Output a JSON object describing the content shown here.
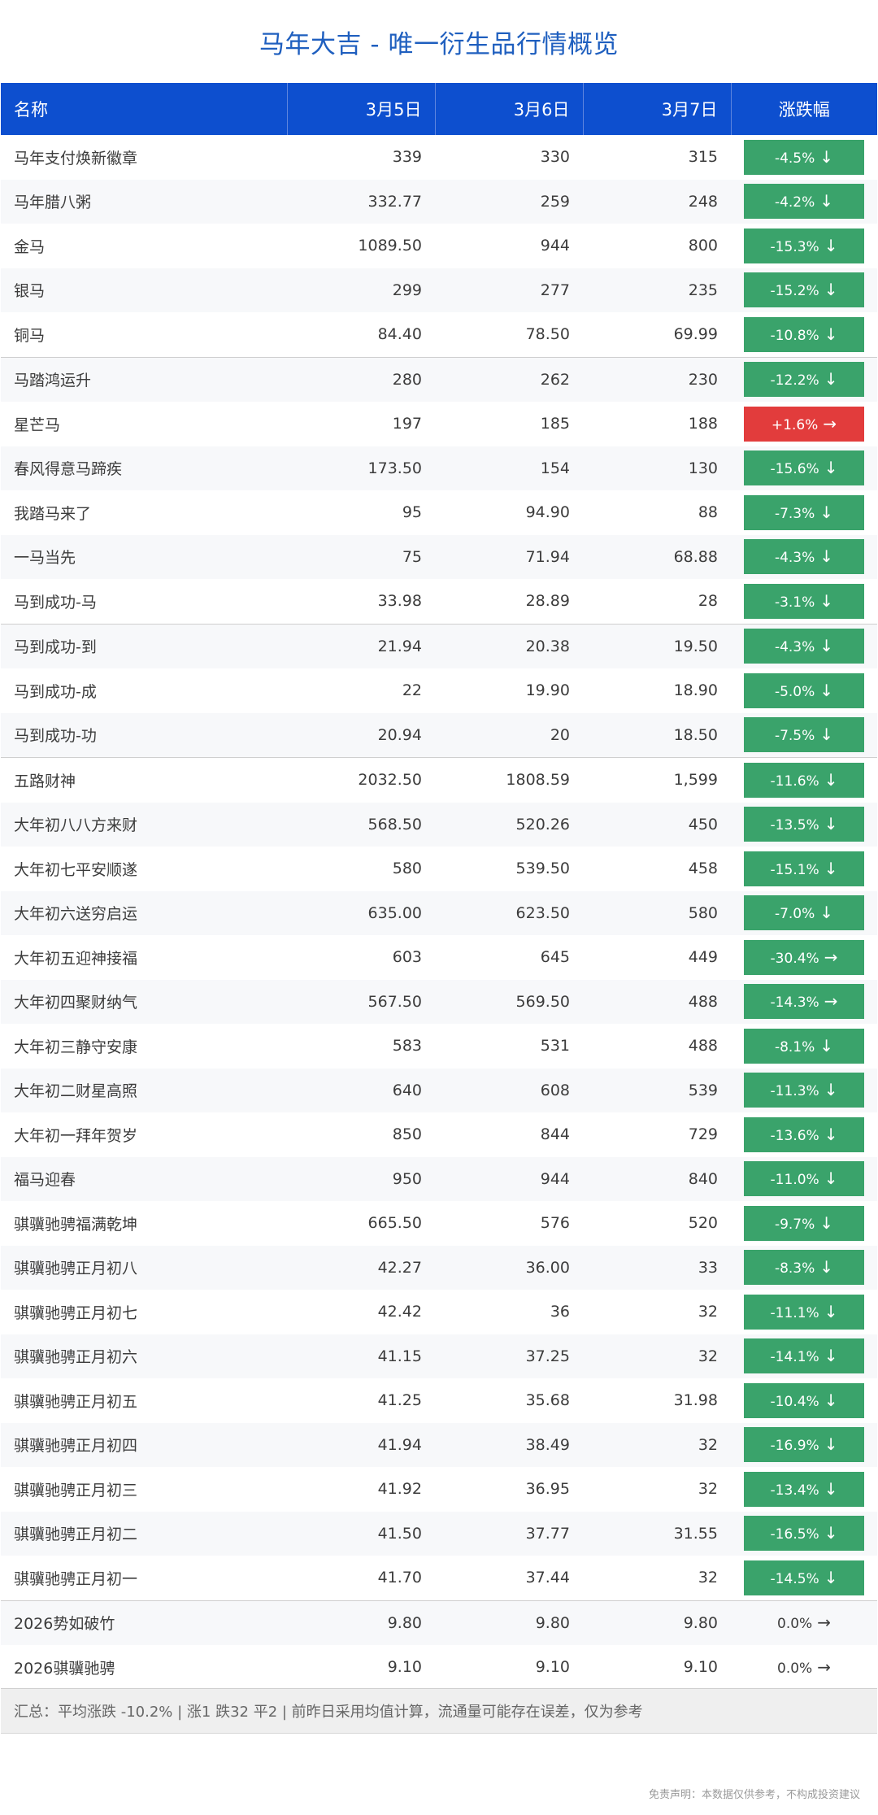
{
  "title": "马年大吉 - 唯一衍生品行情概览",
  "headers": {
    "name": "名称",
    "d1": "3月5日",
    "d2": "3月6日",
    "d3": "3月7日",
    "change": "涨跌幅"
  },
  "colors": {
    "header_bg": "#0d4fcf",
    "title": "#1f5fbf",
    "down": "#3aa36b",
    "up": "#e23c3c"
  },
  "icons": {
    "down": "arrow-down-icon",
    "right": "arrow-right-icon"
  },
  "rows": [
    {
      "name": "马年支付焕新徽章",
      "d1": "339",
      "d2": "330",
      "d3": "315",
      "change": "-4.5%",
      "dir": "down",
      "arrow": "↓",
      "gap": false
    },
    {
      "name": "马年腊八粥",
      "d1": "332.77",
      "d2": "259",
      "d3": "248",
      "change": "-4.2%",
      "dir": "down",
      "arrow": "↓",
      "gap": false
    },
    {
      "name": "金马",
      "d1": "1089.50",
      "d2": "944",
      "d3": "800",
      "change": "-15.3%",
      "dir": "down",
      "arrow": "↓",
      "gap": false
    },
    {
      "name": "银马",
      "d1": "299",
      "d2": "277",
      "d3": "235",
      "change": "-15.2%",
      "dir": "down",
      "arrow": "↓",
      "gap": false
    },
    {
      "name": "铜马",
      "d1": "84.40",
      "d2": "78.50",
      "d3": "69.99",
      "change": "-10.8%",
      "dir": "down",
      "arrow": "↓",
      "gap": false
    },
    {
      "name": "马踏鸿运升",
      "d1": "280",
      "d2": "262",
      "d3": "230",
      "change": "-12.2%",
      "dir": "down",
      "arrow": "↓",
      "gap": true
    },
    {
      "name": "星芒马",
      "d1": "197",
      "d2": "185",
      "d3": "188",
      "change": "+1.6%",
      "dir": "up",
      "arrow": "→",
      "gap": false
    },
    {
      "name": "春风得意马蹄疾",
      "d1": "173.50",
      "d2": "154",
      "d3": "130",
      "change": "-15.6%",
      "dir": "down",
      "arrow": "↓",
      "gap": false
    },
    {
      "name": "我踏马来了",
      "d1": "95",
      "d2": "94.90",
      "d3": "88",
      "change": "-7.3%",
      "dir": "down",
      "arrow": "↓",
      "gap": false
    },
    {
      "name": "一马当先",
      "d1": "75",
      "d2": "71.94",
      "d3": "68.88",
      "change": "-4.3%",
      "dir": "down",
      "arrow": "↓",
      "gap": false
    },
    {
      "name": "马到成功-马",
      "d1": "33.98",
      "d2": "28.89",
      "d3": "28",
      "change": "-3.1%",
      "dir": "down",
      "arrow": "↓",
      "gap": false
    },
    {
      "name": "马到成功-到",
      "d1": "21.94",
      "d2": "20.38",
      "d3": "19.50",
      "change": "-4.3%",
      "dir": "down",
      "arrow": "↓",
      "gap": true
    },
    {
      "name": "马到成功-成",
      "d1": "22",
      "d2": "19.90",
      "d3": "18.90",
      "change": "-5.0%",
      "dir": "down",
      "arrow": "↓",
      "gap": false
    },
    {
      "name": "马到成功-功",
      "d1": "20.94",
      "d2": "20",
      "d3": "18.50",
      "change": "-7.5%",
      "dir": "down",
      "arrow": "↓",
      "gap": false
    },
    {
      "name": "五路财神",
      "d1": "2032.50",
      "d2": "1808.59",
      "d3": "1,599",
      "change": "-11.6%",
      "dir": "down",
      "arrow": "↓",
      "gap": true
    },
    {
      "name": "大年初八八方来财",
      "d1": "568.50",
      "d2": "520.26",
      "d3": "450",
      "change": "-13.5%",
      "dir": "down",
      "arrow": "↓",
      "gap": false
    },
    {
      "name": "大年初七平安顺遂",
      "d1": "580",
      "d2": "539.50",
      "d3": "458",
      "change": "-15.1%",
      "dir": "down",
      "arrow": "↓",
      "gap": false
    },
    {
      "name": "大年初六送穷启运",
      "d1": "635.00",
      "d2": "623.50",
      "d3": "580",
      "change": "-7.0%",
      "dir": "down",
      "arrow": "↓",
      "gap": false
    },
    {
      "name": "大年初五迎神接福",
      "d1": "603",
      "d2": "645",
      "d3": "449",
      "change": "-30.4%",
      "dir": "down",
      "arrow": "→",
      "gap": false
    },
    {
      "name": "大年初四聚财纳气",
      "d1": "567.50",
      "d2": "569.50",
      "d3": "488",
      "change": "-14.3%",
      "dir": "down",
      "arrow": "→",
      "gap": false
    },
    {
      "name": "大年初三静守安康",
      "d1": "583",
      "d2": "531",
      "d3": "488",
      "change": "-8.1%",
      "dir": "down",
      "arrow": "↓",
      "gap": false
    },
    {
      "name": "大年初二财星高照",
      "d1": "640",
      "d2": "608",
      "d3": "539",
      "change": "-11.3%",
      "dir": "down",
      "arrow": "↓",
      "gap": false
    },
    {
      "name": "大年初一拜年贺岁",
      "d1": "850",
      "d2": "844",
      "d3": "729",
      "change": "-13.6%",
      "dir": "down",
      "arrow": "↓",
      "gap": false
    },
    {
      "name": "福马迎春",
      "d1": "950",
      "d2": "944",
      "d3": "840",
      "change": "-11.0%",
      "dir": "down",
      "arrow": "↓",
      "gap": false
    },
    {
      "name": "骐骥驰骋福满乾坤",
      "d1": "665.50",
      "d2": "576",
      "d3": "520",
      "change": "-9.7%",
      "dir": "down",
      "arrow": "↓",
      "gap": false
    },
    {
      "name": "骐骥驰骋正月初八",
      "d1": "42.27",
      "d2": "36.00",
      "d3": "33",
      "change": "-8.3%",
      "dir": "down",
      "arrow": "↓",
      "gap": false
    },
    {
      "name": "骐骥驰骋正月初七",
      "d1": "42.42",
      "d2": "36",
      "d3": "32",
      "change": "-11.1%",
      "dir": "down",
      "arrow": "↓",
      "gap": false
    },
    {
      "name": "骐骥驰骋正月初六",
      "d1": "41.15",
      "d2": "37.25",
      "d3": "32",
      "change": "-14.1%",
      "dir": "down",
      "arrow": "↓",
      "gap": false
    },
    {
      "name": "骐骥驰骋正月初五",
      "d1": "41.25",
      "d2": "35.68",
      "d3": "31.98",
      "change": "-10.4%",
      "dir": "down",
      "arrow": "↓",
      "gap": false
    },
    {
      "name": "骐骥驰骋正月初四",
      "d1": "41.94",
      "d2": "38.49",
      "d3": "32",
      "change": "-16.9%",
      "dir": "down",
      "arrow": "↓",
      "gap": false
    },
    {
      "name": "骐骥驰骋正月初三",
      "d1": "41.92",
      "d2": "36.95",
      "d3": "32",
      "change": "-13.4%",
      "dir": "down",
      "arrow": "↓",
      "gap": false
    },
    {
      "name": "骐骥驰骋正月初二",
      "d1": "41.50",
      "d2": "37.77",
      "d3": "31.55",
      "change": "-16.5%",
      "dir": "down",
      "arrow": "↓",
      "gap": false
    },
    {
      "name": "骐骥驰骋正月初一",
      "d1": "41.70",
      "d2": "37.44",
      "d3": "32",
      "change": "-14.5%",
      "dir": "down",
      "arrow": "↓",
      "gap": false
    },
    {
      "name": "2026势如破竹",
      "d1": "9.80",
      "d2": "9.80",
      "d3": "9.80",
      "change": "0.0%",
      "dir": "flat",
      "arrow": "→",
      "gap": true
    },
    {
      "name": "2026骐骥驰骋",
      "d1": "9.10",
      "d2": "9.10",
      "d3": "9.10",
      "change": "0.0%",
      "dir": "flat",
      "arrow": "→",
      "gap": false
    }
  ],
  "summary": "汇总：平均涨跌 -10.2% | 涨1 跌32 平2 | 前昨日采用均值计算，流通量可能存在误差，仅为参考",
  "disclaimer": "免责声明：本数据仅供参考，不构成投资建议"
}
